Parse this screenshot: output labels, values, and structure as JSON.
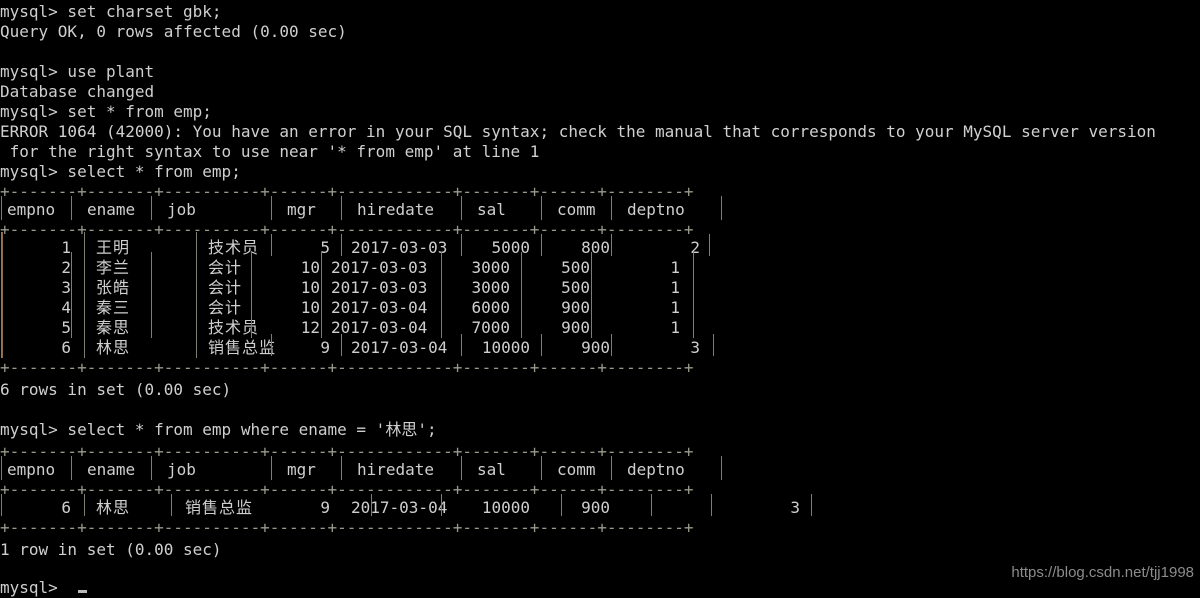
{
  "terminal": {
    "prompt": "mysql>",
    "background_color": "#000000",
    "foreground_color": "#cfcfcf",
    "rule_color": "#9a9a8c",
    "watermark": "https://blog.csdn.net/tjj1998",
    "watermark_color": "#8c8c8c"
  },
  "session": {
    "line_01": "mysql> set charset gbk;",
    "line_02": "Query OK, 0 rows affected (0.00 sec)",
    "line_03": "",
    "line_04": "mysql> use plant",
    "line_05": "Database changed",
    "line_06": "mysql> set * from emp;",
    "line_07": "ERROR 1064 (42000): You have an error in your SQL syntax; check the manual that corresponds to your MySQL server version",
    "line_08": " for the right syntax to use near '* from emp' at line 1",
    "line_09": "mysql> select * from emp;",
    "line_rows_1": "6 rows in set (0.00 sec)",
    "line_blank_2": "",
    "line_query_2": "mysql> select * from emp where ename = '林思';",
    "line_rows_2": "1 row in set (0.00 sec)",
    "line_final_prompt": "mysql>"
  },
  "commands": {
    "set_charset": "set charset gbk;",
    "use_plant": "use plant",
    "bad_select": "set * from emp;",
    "select_all": "select * from emp;",
    "select_where": "select * from emp where ename = '林思';"
  },
  "messages": {
    "query_ok": "Query OK, 0 rows affected (0.00 sec)",
    "database_changed": "Database changed",
    "error_line_1": "ERROR 1064 (42000): You have an error in your SQL syntax; check the manual that corresponds to your MySQL server version",
    "error_line_2": " for the right syntax to use near '* from emp' at line 1",
    "rows_6": "6 rows in set (0.00 sec)",
    "rows_1": "1 row in set (0.00 sec)"
  },
  "table_1": {
    "border": "+-------+-------+----------+------+------------+-------+------+--------+",
    "headers": [
      "empno",
      "ename",
      "job",
      "mgr",
      "hiredate",
      "sal",
      "comm",
      "deptno"
    ],
    "rows": [
      {
        "empno": "1",
        "ename": "王明",
        "job": "技术员",
        "mgr": "5",
        "hiredate": "2017-03-03",
        "sal": "5000",
        "comm": "800",
        "deptno": "2"
      },
      {
        "empno": "2",
        "ename": "李兰",
        "job": "会计",
        "mgr": "10",
        "hiredate": "2017-03-03",
        "sal": "3000",
        "comm": "500",
        "deptno": "1"
      },
      {
        "empno": "3",
        "ename": "张皓",
        "job": "会计",
        "mgr": "10",
        "hiredate": "2017-03-03",
        "sal": "3000",
        "comm": "500",
        "deptno": "1"
      },
      {
        "empno": "4",
        "ename": "秦三",
        "job": "会计",
        "mgr": "10",
        "hiredate": "2017-03-04",
        "sal": "6000",
        "comm": "900",
        "deptno": "1"
      },
      {
        "empno": "5",
        "ename": "秦思",
        "job": "技术员",
        "mgr": "12",
        "hiredate": "2017-03-04",
        "sal": "7000",
        "comm": "900",
        "deptno": "1"
      },
      {
        "empno": "6",
        "ename": "林思",
        "job": "销售总监",
        "mgr": "9",
        "hiredate": "2017-03-04",
        "sal": "10000",
        "comm": "900",
        "deptno": "3"
      }
    ]
  },
  "table_2": {
    "border": "+-------+-------+----------+------+------------+-------+------+--------+",
    "headers": [
      "empno",
      "ename",
      "job",
      "mgr",
      "hiredate",
      "sal",
      "comm",
      "deptno"
    ],
    "rows": [
      {
        "empno": "6",
        "ename": "林思",
        "job": "销售总监",
        "mgr": "9",
        "hiredate": "2017-03-04",
        "sal": "10000",
        "comm": "900",
        "deptno": "3"
      }
    ]
  }
}
